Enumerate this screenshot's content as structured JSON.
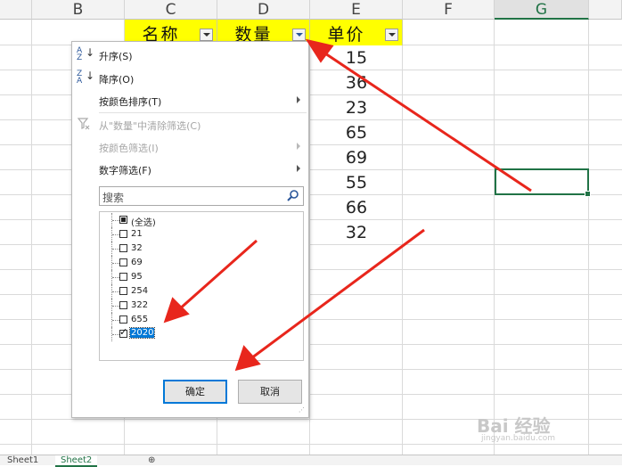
{
  "columns": [
    "B",
    "C",
    "D",
    "E",
    "F",
    "G"
  ],
  "selected_column": "G",
  "header_row": [
    "名称",
    "数量",
    "单价"
  ],
  "unit_prices": [
    "15",
    "36",
    "23",
    "65",
    "69",
    "55",
    "66",
    "32"
  ],
  "menu": {
    "sort_asc": "升序(S)",
    "sort_desc": "降序(O)",
    "sort_by_color": "按颜色排序(T)",
    "clear_filter": "从\"数量\"中清除筛选(C)",
    "filter_by_color": "按颜色筛选(I)",
    "number_filter": "数字筛选(F)"
  },
  "search": {
    "placeholder": "搜索"
  },
  "filter_list": [
    {
      "label": "(全选)",
      "state": "partial"
    },
    {
      "label": "21",
      "state": "unchecked"
    },
    {
      "label": "32",
      "state": "unchecked"
    },
    {
      "label": "69",
      "state": "unchecked"
    },
    {
      "label": "95",
      "state": "unchecked"
    },
    {
      "label": "254",
      "state": "unchecked"
    },
    {
      "label": "322",
      "state": "unchecked"
    },
    {
      "label": "655",
      "state": "unchecked"
    },
    {
      "label": "2020",
      "state": "checked"
    }
  ],
  "buttons": {
    "ok": "确定",
    "cancel": "取消"
  },
  "sheet_tabs": [
    "Sheet1",
    "Sheet2"
  ],
  "active_sheet": "Sheet2",
  "watermark": {
    "main": "Bai 经验",
    "sub": "jingyan.baidu.com"
  },
  "colors": {
    "header_fill": "#ffff00",
    "selection": "#217346",
    "annotation_arrow": "#e8261c",
    "highlight": "#0078d7"
  }
}
